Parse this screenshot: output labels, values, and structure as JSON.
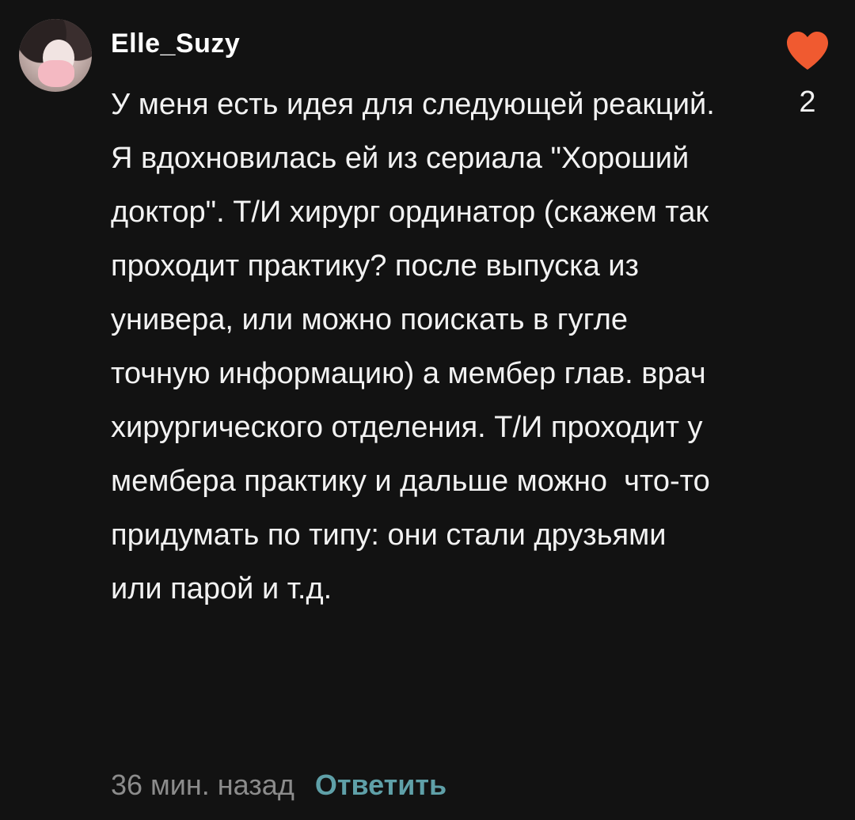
{
  "comment": {
    "username": "Elle_Suzy",
    "text": "У меня есть идея для следующей реакций. Я вдохновилась ей из сериала \"Хороший доктор\". Т/И хирург ординатор (скажем так проходит практику? после выпуска из универа, или можно поискать в гугле точную информацию) а мембер глав. врач хирургического отделения. Т/И проходит у мембера практику и дальше можно  что-то придумать по типу: они стали друзьями или парой и т.д.",
    "time": "36 мин. назад",
    "reply_label": "Ответить",
    "like_count": "2",
    "like_icon": "heart-icon",
    "avatar_icon": "avatar"
  },
  "colors": {
    "background": "#121212",
    "heart": "#f05a30",
    "reply": "#5fa0a8",
    "time": "#8c8c8c"
  }
}
